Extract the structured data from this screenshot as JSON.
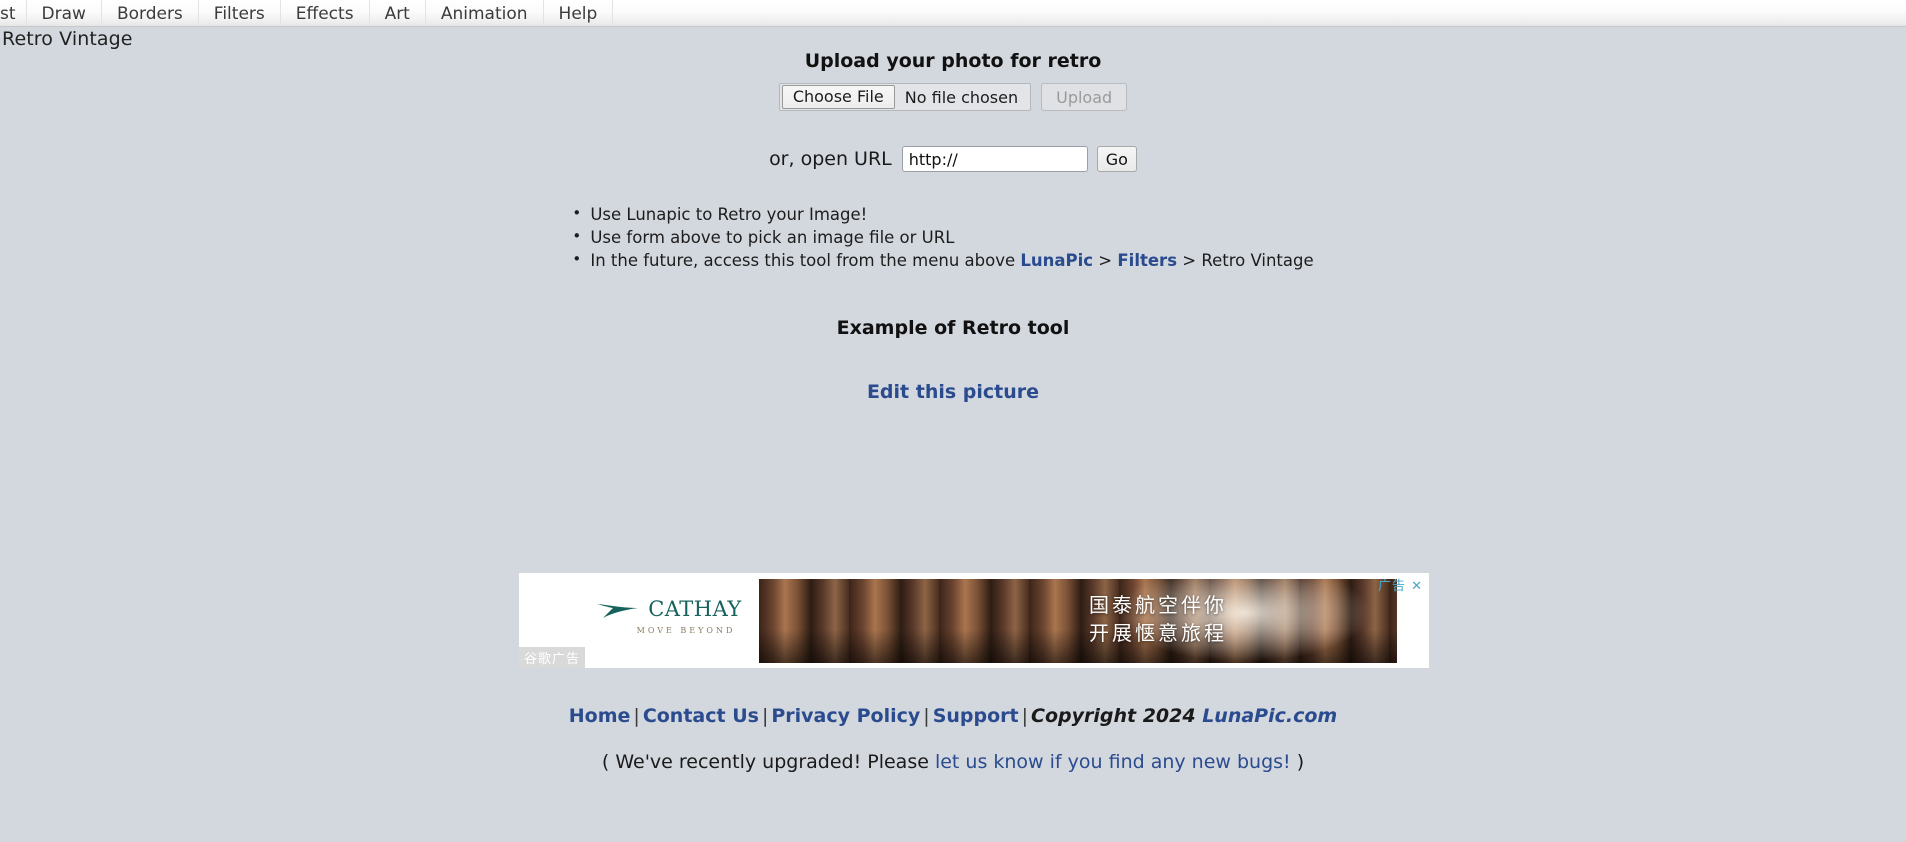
{
  "nav": {
    "items": [
      {
        "label": "st",
        "clipped": true
      },
      {
        "label": "Draw",
        "clipped": false
      },
      {
        "label": "Borders",
        "clipped": false
      },
      {
        "label": "Filters",
        "clipped": false
      },
      {
        "label": "Effects",
        "clipped": false
      },
      {
        "label": "Art",
        "clipped": false
      },
      {
        "label": "Animation",
        "clipped": false
      },
      {
        "label": "Help",
        "clipped": false
      }
    ]
  },
  "page": {
    "title": "Retro Vintage"
  },
  "upload": {
    "heading": "Upload your photo for retro",
    "choose_file_label": "Choose File",
    "no_file_text": "No file chosen",
    "upload_button_label": "Upload",
    "upload_button_disabled": true
  },
  "url_form": {
    "label": "or, open URL",
    "value": "http://",
    "placeholder": "http://",
    "go_label": "Go"
  },
  "tips": {
    "item1": "Use Lunapic to Retro your Image!",
    "item2": "Use form above to pick an image file or URL",
    "item3_pre": "In the future, access this tool from the menu above ",
    "item3_link1": "LunaPic",
    "item3_sep1": " > ",
    "item3_link2": "Filters",
    "item3_sep2": " > ",
    "item3_post": "Retro Vintage"
  },
  "example": {
    "heading": "Example of Retro tool",
    "edit_link": "Edit this picture"
  },
  "ad": {
    "brand": "CATHAY",
    "tagline": "MOVE BEYOND",
    "headline_line1": "国泰航空伴你",
    "headline_line2": "开展惬意旅程",
    "badge": "谷歌广告",
    "close_label": "广告 ✕",
    "brand_color": "#17625d"
  },
  "footer": {
    "home": "Home",
    "contact": "Contact Us",
    "privacy": "Privacy Policy",
    "support": "Support",
    "separator": "|",
    "copyright": "Copyright 2024 ",
    "site": "LunaPic.com",
    "notice_pre": "( We've recently upgraded! Please ",
    "notice_link": "let us know if you find any new bugs!",
    "notice_post": " )"
  }
}
